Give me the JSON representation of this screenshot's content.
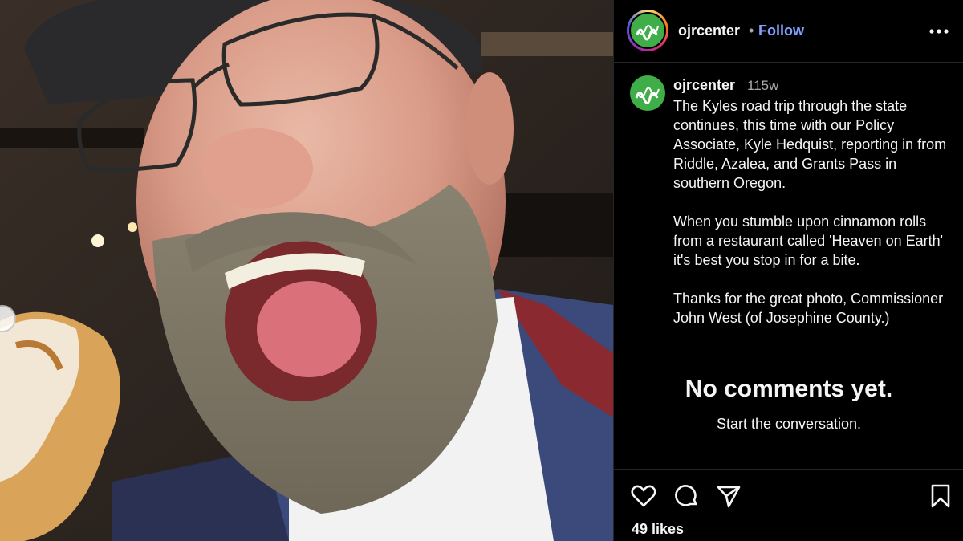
{
  "photo": {
    "alt_icon": "post-photo"
  },
  "header": {
    "username": "ojrcenter",
    "separator": "•",
    "follow_label": "Follow",
    "more_icon": "more-horizontal-icon"
  },
  "caption": {
    "username": "ojrcenter",
    "time": "115w",
    "paragraphs": [
      "The Kyles road trip through the state continues, this time with our Policy Associate, Kyle Hedquist, reporting in from Riddle, Azalea, and Grants Pass in southern Oregon.",
      "When you stumble upon cinnamon rolls from a restaurant called 'Heaven on Earth' it's best you stop in for a bite.",
      "Thanks for the great photo, Commissioner John West (of Josephine County.)"
    ]
  },
  "comments": {
    "empty_title": "No comments yet.",
    "empty_subtitle": "Start the conversation."
  },
  "actions": {
    "like_icon": "heart-icon",
    "comment_icon": "comment-icon",
    "share_icon": "share-icon",
    "save_icon": "bookmark-icon",
    "likes": "49 likes"
  },
  "colors": {
    "follow": "#85a1ff",
    "avatar": "#3fae49",
    "background": "#000000"
  }
}
